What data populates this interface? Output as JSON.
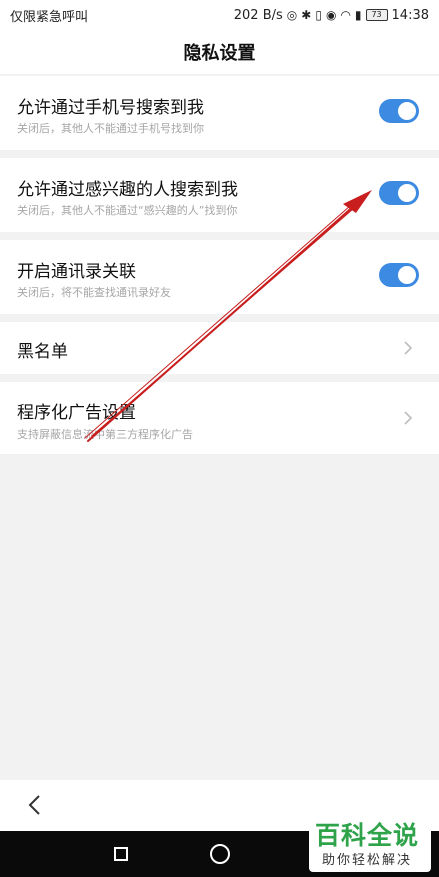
{
  "status_bar": {
    "carrier": "仅限紧急呼叫",
    "speed": "202 B/s",
    "battery": "73",
    "time": "14:38"
  },
  "header": {
    "title": "隐私设置"
  },
  "settings": {
    "phone_search": {
      "label": "允许通过手机号搜索到我",
      "desc": "关闭后，其他人不能通过手机号找到你",
      "enabled": true
    },
    "interest_search": {
      "label": "允许通过感兴趣的人搜索到我",
      "desc": "关闭后，其他人不能通过“感兴趣的人”找到你",
      "enabled": true
    },
    "contacts_link": {
      "label": "开启通讯录关联",
      "desc": "关闭后，将不能查找通讯录好友",
      "enabled": true
    },
    "blacklist": {
      "label": "黑名单"
    },
    "programmatic_ads": {
      "label": "程序化广告设置",
      "desc": "支持屏蔽信息流中第三方程序化广告"
    }
  },
  "watermark": {
    "title": "百科全说",
    "subtitle": "助你轻松解决"
  },
  "colors": {
    "toggle_on": "#3d8ae3",
    "annotation_arrow": "#c81e1e",
    "watermark_green": "#2fa34a"
  }
}
